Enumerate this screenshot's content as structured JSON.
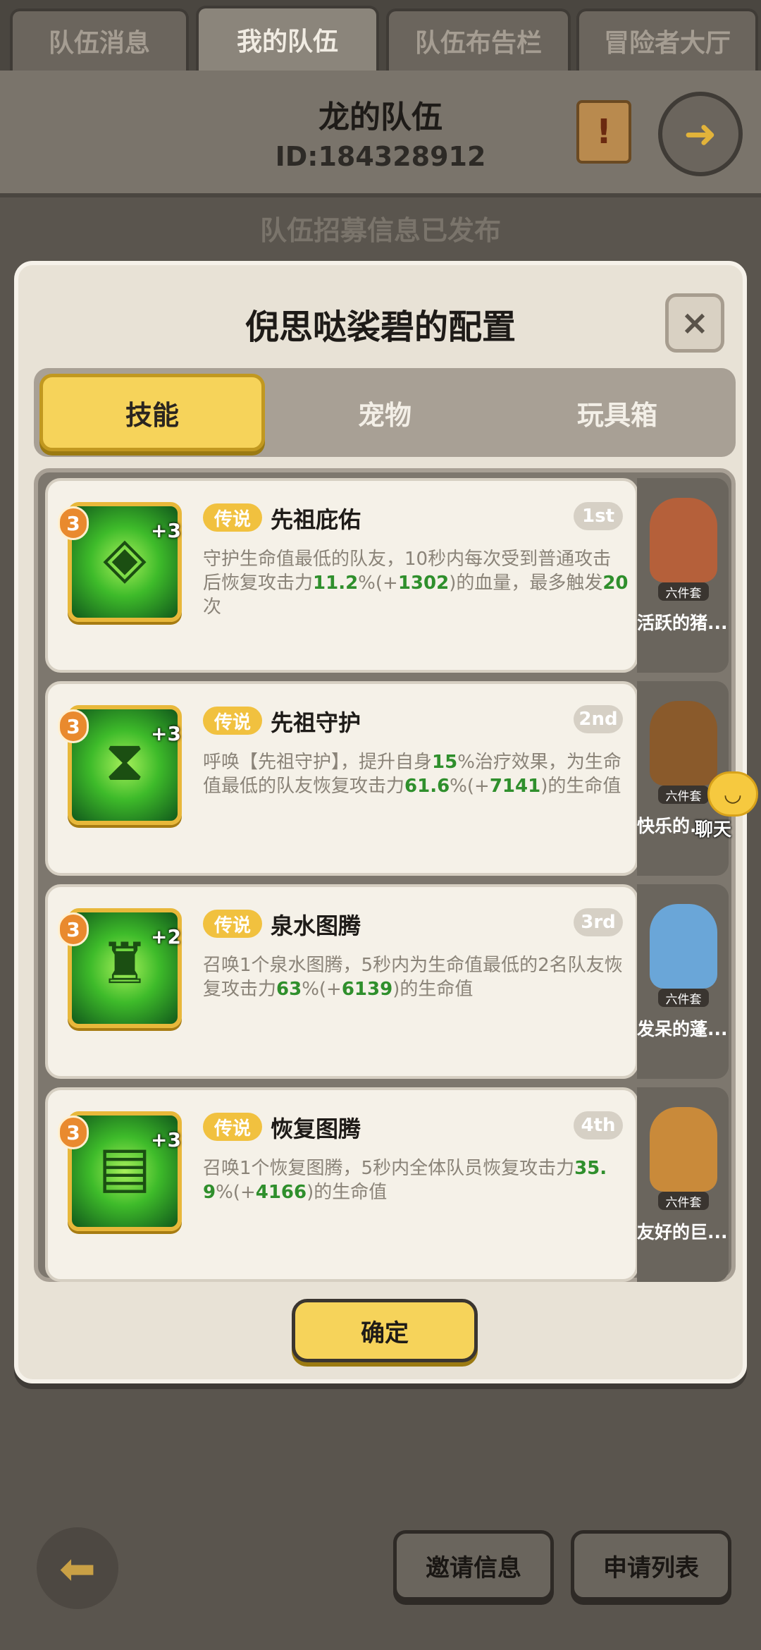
{
  "top_tabs": [
    {
      "label": "队伍消息"
    },
    {
      "label": "我的队伍"
    },
    {
      "label": "队伍布告栏"
    },
    {
      "label": "冒险者大厅"
    }
  ],
  "header": {
    "team_name": "龙的队伍",
    "team_id": "ID:184328912",
    "notice_icon": "scroll-notice-icon",
    "exit_icon": "exit-door-icon"
  },
  "recruit_status": "队伍招募信息已发布",
  "modal": {
    "title": "倪思哒裟碧的配置",
    "close_label": "×",
    "segments": [
      {
        "label": "技能"
      },
      {
        "label": "宠物"
      },
      {
        "label": "玩具箱"
      }
    ],
    "skills": [
      {
        "level": "3",
        "plus": "+3",
        "tag": "传说",
        "name": "先祖庇佑",
        "rank": "1st",
        "desc": [
          "守护生命值最低的队友，10秒内每次受到普通攻击后恢复攻击力",
          "11.2",
          "%(+",
          "1302",
          ")的血量，最多触发",
          "20",
          "次"
        ]
      },
      {
        "level": "3",
        "plus": "+3",
        "tag": "传说",
        "name": "先祖守护",
        "rank": "2nd",
        "desc": [
          "呼唤【先祖守护】，提升自身",
          "15",
          "%治疗效果，为生命值最低的队友恢复攻击力",
          "61.6",
          "%(+",
          "7141",
          ")的生命值"
        ]
      },
      {
        "level": "3",
        "plus": "+2",
        "tag": "传说",
        "name": "泉水图腾",
        "rank": "3rd",
        "desc": [
          "召唤1个泉水图腾，5秒内为生命值最低的2名队友恢复攻击力",
          "63",
          "%(+",
          "6139",
          ")的生命值"
        ]
      },
      {
        "level": "3",
        "plus": "+3",
        "tag": "传说",
        "name": "恢复图腾",
        "rank": "4th",
        "desc": [
          "召唤1个恢复图腾，5秒内全体队员恢复攻击力",
          "35.9",
          "%(+",
          "4166",
          ")的生命值"
        ]
      }
    ],
    "pets": [
      {
        "name": "活跃的猪...",
        "badge": "六件套",
        "color": "#b5603a"
      },
      {
        "name": "快乐的...",
        "badge": "六件套",
        "color": "#8a5a2b"
      },
      {
        "name": "发呆的蓬...",
        "badge": "六件套",
        "color": "#6aa6d8"
      },
      {
        "name": "友好的巨...",
        "badge": "六件套",
        "color": "#c98a3a"
      }
    ],
    "confirm_label": "确定"
  },
  "chat": {
    "label": "聊天"
  },
  "bottom": {
    "back_icon": "back-arrow-icon",
    "invite_label": "邀请信息",
    "apply_label": "申请列表"
  }
}
